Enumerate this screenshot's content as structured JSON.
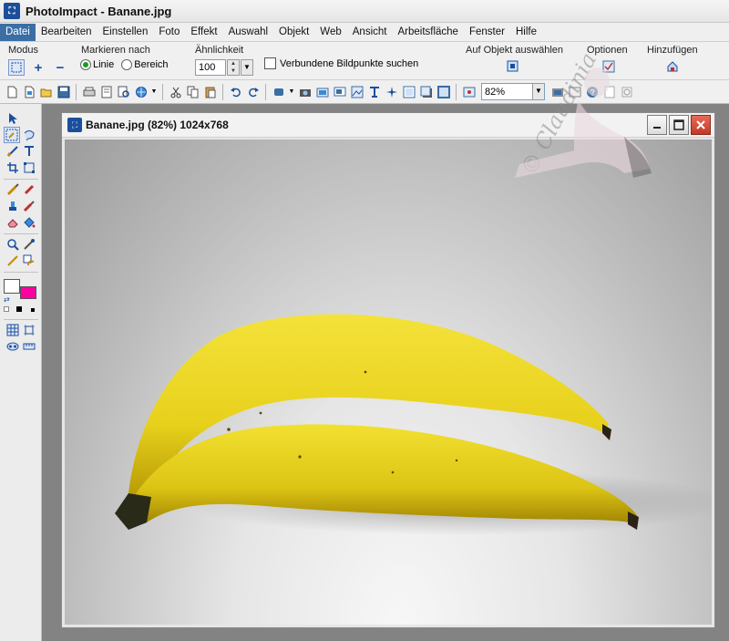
{
  "app": {
    "title": "PhotoImpact - Banane.jpg"
  },
  "menu": {
    "items": [
      "Datei",
      "Bearbeiten",
      "Einstellen",
      "Foto",
      "Effekt",
      "Auswahl",
      "Objekt",
      "Web",
      "Ansicht",
      "Arbeitsfläche",
      "Fenster",
      "Hilfe"
    ]
  },
  "attrbar": {
    "modus_label": "Modus",
    "markieren_label": "Markieren nach",
    "linie_label": "Linie",
    "bereich_label": "Bereich",
    "aehnlichkeit_label": "Ähnlichkeit",
    "aehnlichkeit_value": "100",
    "verbundene_label": "Verbundene Bildpunkte suchen",
    "auf_objekt_label": "Auf Objekt auswählen",
    "optionen_label": "Optionen",
    "hinzufuegen_label": "Hinzufügen",
    "selected_mode": "Linie"
  },
  "stdbar": {
    "zoom_value": "82%"
  },
  "image_window": {
    "title": "Banane.jpg (82%) 1024x768"
  },
  "colors": {
    "foreground": "#ffffff",
    "background": "#ff00a0",
    "accent": "#3a6ea5"
  },
  "watermark": {
    "text": "© Claudinia"
  }
}
